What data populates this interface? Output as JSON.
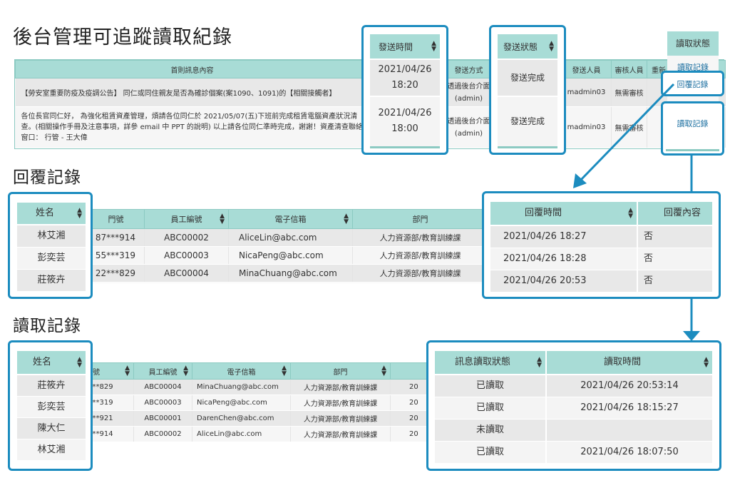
{
  "page_title": "後台管理可追蹤讀取紀錄",
  "top_table": {
    "header_content": "首則訊息內容",
    "header_method": "發送方式",
    "header_sender": "發送人員",
    "header_reviewer": "審核人員",
    "header_other": "重新",
    "rows": [
      {
        "content": "【勞安室重要防疫及疫調公告】 同仁或同住親友是否為確診個案(案1090、1091)的【相關接觸者】",
        "method": "透過後台介面\n(admin)",
        "sender": "madmin03",
        "reviewer": "無需審核"
      },
      {
        "content": "各位長官同仁好， 為強化租賃資產管理，煩請各位同仁於 2021/05/07(五)下班前完成租賃電腦資產狀況清查。(相關操作手冊及注意事項，詳參 email 中 PPT 的說明) 以上請各位同仁準時完成，謝謝！資產清查聯絡窗口： 行管 - 王大偉",
        "method": "透過後台介面\n(admin)",
        "sender": "madmin03",
        "reviewer": "無需審核"
      }
    ]
  },
  "send_time_box": {
    "header": "發送時間",
    "values": [
      "2021/04/26\n18:20",
      "2021/04/26\n18:00"
    ]
  },
  "send_status_box": {
    "header": "發送狀態",
    "values": [
      "發送完成",
      "發送完成"
    ]
  },
  "read_status_box": {
    "header": "讀取狀態",
    "link_read_1": "讀取記錄",
    "link_reply": "回覆記錄",
    "link_read_2": "讀取記錄"
  },
  "reply_section": {
    "title": "回覆記錄",
    "headers": {
      "name": "姓名",
      "door": "門號",
      "emp_no": "員工編號",
      "email": "電子信箱",
      "dept": "部門",
      "reply_time": "回覆時間",
      "reply_content": "回覆內容"
    },
    "rows": [
      {
        "name": "林艾湘",
        "door": "87***914",
        "emp_no": "ABC00002",
        "email": "AliceLin@abc.com",
        "dept": "人力資源部/教育訓練課",
        "reply_time": "2021/04/26 18:27",
        "reply_content": "否"
      },
      {
        "name": "彭奕芸",
        "door": "55***319",
        "emp_no": "ABC00003",
        "email": "NicaPeng@abc.com",
        "dept": "人力資源部/教育訓練課",
        "reply_time": "2021/04/26 18:28",
        "reply_content": "否"
      },
      {
        "name": "莊筱卉",
        "door": "22***829",
        "emp_no": "ABC00004",
        "email": "MinaChuang@abc.com",
        "dept": "人力資源部/教育訓練課",
        "reply_time": "2021/04/26 20:53",
        "reply_content": "否"
      }
    ]
  },
  "read_section": {
    "title": "讀取記錄",
    "headers": {
      "name": "姓名",
      "door": "號",
      "emp_no": "員工編號",
      "email": "電子信箱",
      "dept": "部門",
      "status": "訊息讀取狀態",
      "read_time": "讀取時間"
    },
    "rows": [
      {
        "name": "莊筱卉",
        "door": "**829",
        "emp_no": "ABC00004",
        "email": "MinaChuang@abc.com",
        "dept": "人力資源部/教育訓練課",
        "extra": "20",
        "status": "已讀取",
        "read_time": "2021/04/26 20:53:14"
      },
      {
        "name": "彭奕芸",
        "door": "**319",
        "emp_no": "ABC00003",
        "email": "NicaPeng@abc.com",
        "dept": "人力資源部/教育訓練課",
        "extra": "20",
        "status": "已讀取",
        "read_time": "2021/04/26 18:15:27"
      },
      {
        "name": "陳大仁",
        "door": "**921",
        "emp_no": "ABC00001",
        "email": "DarenChen@abc.com",
        "dept": "人力資源部/教育訓練課",
        "extra": "20",
        "status": "未讀取",
        "read_time": ""
      },
      {
        "name": "林艾湘",
        "door": "**914",
        "emp_no": "ABC00002",
        "email": "AliceLin@abc.com",
        "dept": "人力資源部/教育訓練課",
        "extra": "20",
        "status": "已讀取",
        "read_time": "2021/04/26 18:07:50"
      }
    ]
  },
  "colors": {
    "accent": "#1c8cbf",
    "header_bg": "#a8dcd6"
  }
}
